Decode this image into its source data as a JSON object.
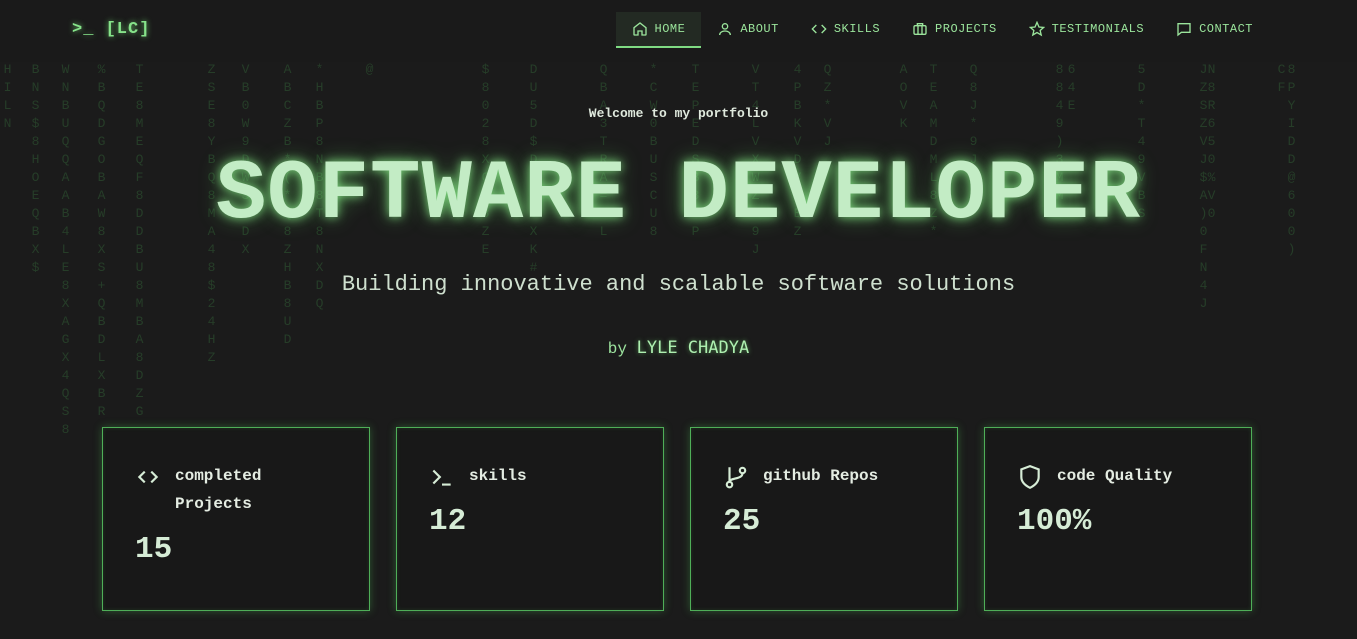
{
  "nav": {
    "logo": ">_ [LC]",
    "items": [
      {
        "label": "HOME",
        "icon": "home-icon",
        "active": true
      },
      {
        "label": "ABOUT",
        "icon": "user-icon"
      },
      {
        "label": "SKILLS",
        "icon": "code-icon"
      },
      {
        "label": "PROJECTS",
        "icon": "briefcase-icon"
      },
      {
        "label": "TESTIMONIALS",
        "icon": "star-icon"
      },
      {
        "label": "CONTACT",
        "icon": "message-icon"
      }
    ]
  },
  "hero": {
    "welcome": "Welcome to my portfolio",
    "title": "SOFTWARE DEVELOPER",
    "subtitle": "Building innovative and scalable software solutions",
    "by": "by",
    "name": "LYLE CHADYA"
  },
  "stats": [
    {
      "label": "completed Projects",
      "value": "15",
      "icon": "code-icon"
    },
    {
      "label": "skills",
      "value": "12",
      "icon": "terminal-icon"
    },
    {
      "label": "github Repos",
      "value": "25",
      "icon": "git-branch-icon"
    },
    {
      "label": "code Quality",
      "value": "100%",
      "icon": "shield-icon"
    }
  ],
  "colors": {
    "background": "#1b1b1b",
    "accent": "#7fdc83",
    "card_border": "#4fae58"
  }
}
